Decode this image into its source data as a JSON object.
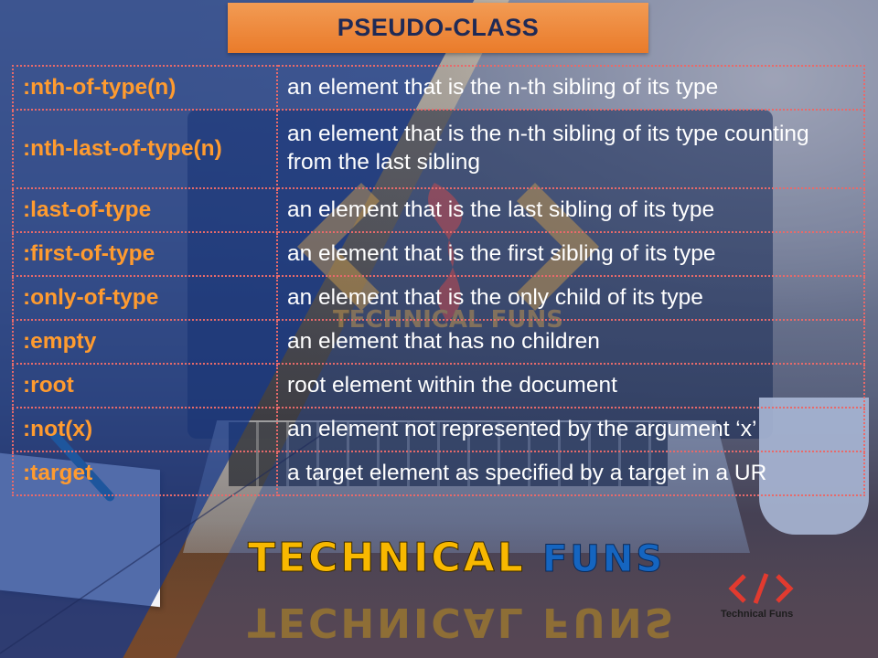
{
  "title": "PSEUDO-CLASS",
  "rows": [
    {
      "name": ":nth-of-type(n)",
      "desc": "an element that is the n-th sibling of its type"
    },
    {
      "name": ":nth-last-of-type(n)",
      "desc": "an element that is the n-th sibling of its type counting from the last sibling"
    },
    {
      "name": ":last-of-type",
      "desc": "an element that is the last sibling of its type"
    },
    {
      "name": ":first-of-type",
      "desc": "an element that is the first sibling of its type"
    },
    {
      "name": ":only-of-type",
      "desc": "an element that is the only child of its type"
    },
    {
      "name": ":empty",
      "desc": "an element that has no children"
    },
    {
      "name": ":root",
      "desc": "root element within the document"
    },
    {
      "name": ":not(x)",
      "desc": "an element not represented by the argument ‘x’"
    },
    {
      "name": ":target",
      "desc": "a target element as specified by a target in a UR"
    }
  ],
  "brand": {
    "word1": "TECHNICAL",
    "word2": "FUNS",
    "watermark": "TECHNICAL FUNS"
  },
  "corner_logo": {
    "label": "Technical Funs",
    "icon": "code-brackets-icon"
  },
  "colors": {
    "title_bg": "#ea7b2a",
    "title_text": "#1f2a56",
    "name_text": "#ff9b2f",
    "border": "#e86a6a",
    "brand_yellow": "#f8b800",
    "brand_blue": "#1565c0"
  }
}
